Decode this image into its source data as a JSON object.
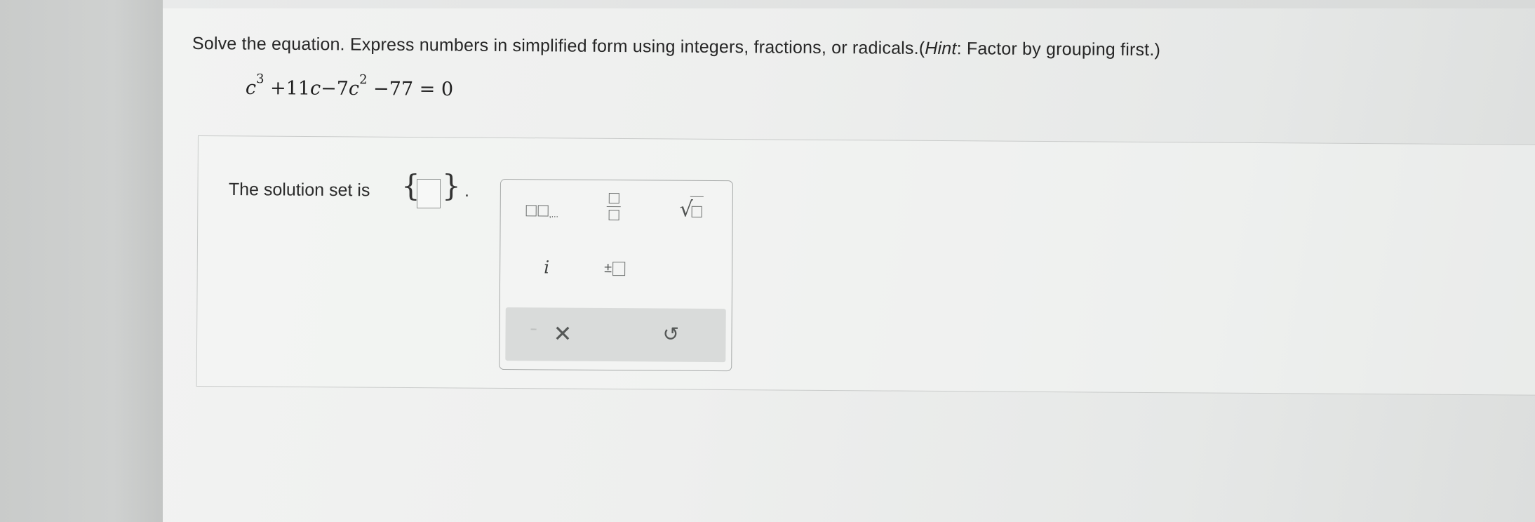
{
  "question": {
    "instructions_prefix": "Solve the equation. Express numbers in simplified form using integers, fractions, or radicals.(",
    "hint_label": "Hint",
    "instructions_suffix": ": Factor by grouping first.)",
    "equation": {
      "t1_var": "c",
      "t1_exp": "3",
      "t2": " +11",
      "t2_var": "c",
      "t3": "−7",
      "t3_var": "c",
      "t3_exp": "2",
      "t4": " −77 = 0"
    }
  },
  "answer": {
    "label": "The solution set is",
    "open_brace": "{",
    "close_brace": "}",
    "period": ".",
    "value": ""
  },
  "palette": {
    "list_dots": ",...",
    "sqrt_symbol": "√",
    "i_label": "i",
    "pm_label": "±",
    "clear_symbol": "✕",
    "undo_symbol": "↺"
  }
}
